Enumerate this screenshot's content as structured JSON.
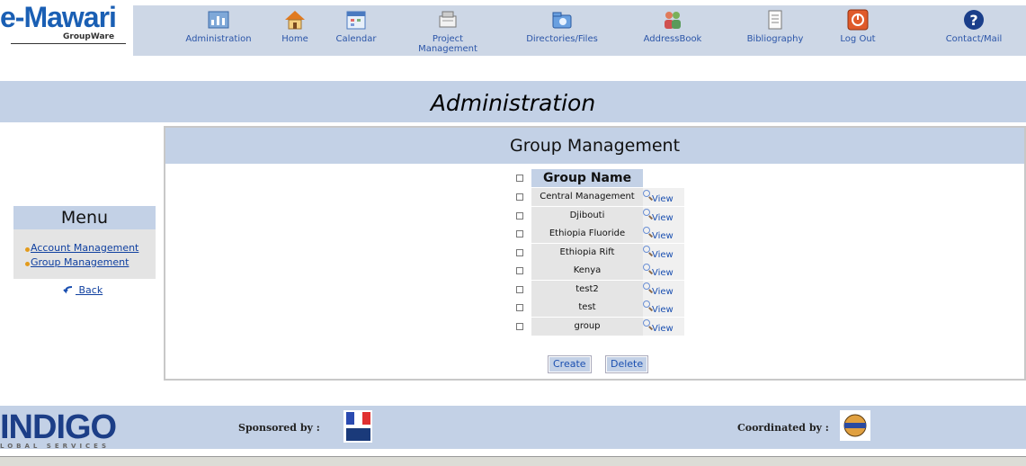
{
  "logo": {
    "text": "e-Mawari",
    "sub": "GroupWare"
  },
  "nav": [
    {
      "label": "Administration",
      "icon": "administration-icon"
    },
    {
      "label": "Home",
      "icon": "home-icon"
    },
    {
      "label": "Calendar",
      "icon": "calendar-icon"
    },
    {
      "label": "Project\nManagement",
      "icon": "project-management-icon"
    },
    {
      "label": "Directories/Files",
      "icon": "directories-files-icon"
    },
    {
      "label": "AddressBook",
      "icon": "addressbook-icon"
    },
    {
      "label": "Bibliography",
      "icon": "bibliography-icon"
    },
    {
      "label": "Log Out",
      "icon": "logout-icon"
    },
    {
      "label": "Contact/Mail",
      "icon": "contact-mail-icon"
    }
  ],
  "page": {
    "title": "Administration"
  },
  "menu": {
    "title": "Menu",
    "items": [
      "Account Management",
      "Group Management"
    ],
    "back": "Back"
  },
  "panel": {
    "title": "Group Management",
    "column_header": "Group Name",
    "view_label": "View",
    "groups": [
      "Central Management",
      "Djibouti",
      "Ethiopia Fluoride",
      "Ethiopia Rift",
      "Kenya",
      "test2",
      "test",
      "group"
    ],
    "buttons": {
      "create": "Create",
      "delete": "Delete"
    }
  },
  "footer": {
    "logo": "INDIGO",
    "logo_sub": "LOBAL SERVICES",
    "sponsored": "Sponsored by :",
    "coordinated": "Coordinated by :"
  },
  "colors": {
    "band": "#c3d1e6",
    "nav": "#cdd7e6",
    "link": "#2b55a8"
  }
}
